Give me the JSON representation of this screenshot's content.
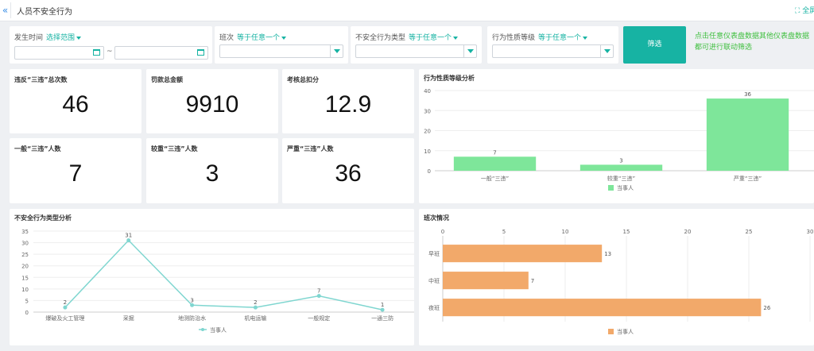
{
  "header": {
    "collapse_icon": "«",
    "title": "人员不安全行为",
    "fullscreen_label": "全屏"
  },
  "filters": {
    "time": {
      "label": "发生时间",
      "link": "选择范围",
      "separator": "~"
    },
    "shift": {
      "label": "班次",
      "link": "等于任意一个"
    },
    "behavior_type": {
      "label": "不安全行为类型",
      "link": "等于任意一个"
    },
    "severity": {
      "label": "行为性质等级",
      "link": "等于任意一个"
    },
    "filter_button": "筛选",
    "hint": "点击任意仪表盘数据其他仪表盘数据都可进行联动筛选"
  },
  "kpis": [
    {
      "title": "违反“三违”总次数",
      "value": "46"
    },
    {
      "title": "罚款总金额",
      "value": "9910"
    },
    {
      "title": "考核总扣分",
      "value": "12.9"
    },
    {
      "title": "一般“三违”人数",
      "value": "7"
    },
    {
      "title": "较重“三违”人数",
      "value": "3"
    },
    {
      "title": "严重“三违”人数",
      "value": "36"
    }
  ],
  "colors": {
    "accent": "#17b3a3",
    "bar_green": "#7ee69a",
    "line_teal": "#7fd6d0",
    "bar_orange": "#f2a96a",
    "hint_green": "#3fbf3f"
  },
  "chart_data": [
    {
      "type": "bar",
      "title": "行为性质等级分析",
      "categories": [
        "一般“三违”",
        "较重“三违”",
        "严重“三违”"
      ],
      "series": [
        {
          "name": "当事人",
          "values": [
            7,
            3,
            36
          ]
        }
      ],
      "ylim": [
        0,
        40
      ],
      "yticks": [
        0,
        10,
        20,
        30,
        40
      ],
      "legend": "bottom-center"
    },
    {
      "type": "line",
      "title": "不安全行为类型分析",
      "categories": [
        "爆破及火工管理",
        "采掘",
        "地测防治水",
        "机电运输",
        "一般规定",
        "一通三防"
      ],
      "series": [
        {
          "name": "当事人",
          "values": [
            2,
            31,
            3,
            2,
            7,
            1
          ]
        }
      ],
      "ylim": [
        0,
        35
      ],
      "yticks": [
        0,
        5,
        10,
        15,
        20,
        25,
        30,
        35
      ],
      "legend": "bottom-center"
    },
    {
      "type": "bar",
      "orientation": "horizontal",
      "title": "班次情况",
      "categories": [
        "早班",
        "中班",
        "夜班"
      ],
      "series": [
        {
          "name": "当事人",
          "values": [
            13,
            7,
            26
          ]
        }
      ],
      "xlim": [
        0,
        30
      ],
      "xticks": [
        0,
        5,
        10,
        15,
        20,
        25,
        30
      ],
      "legend": "bottom-center"
    }
  ]
}
